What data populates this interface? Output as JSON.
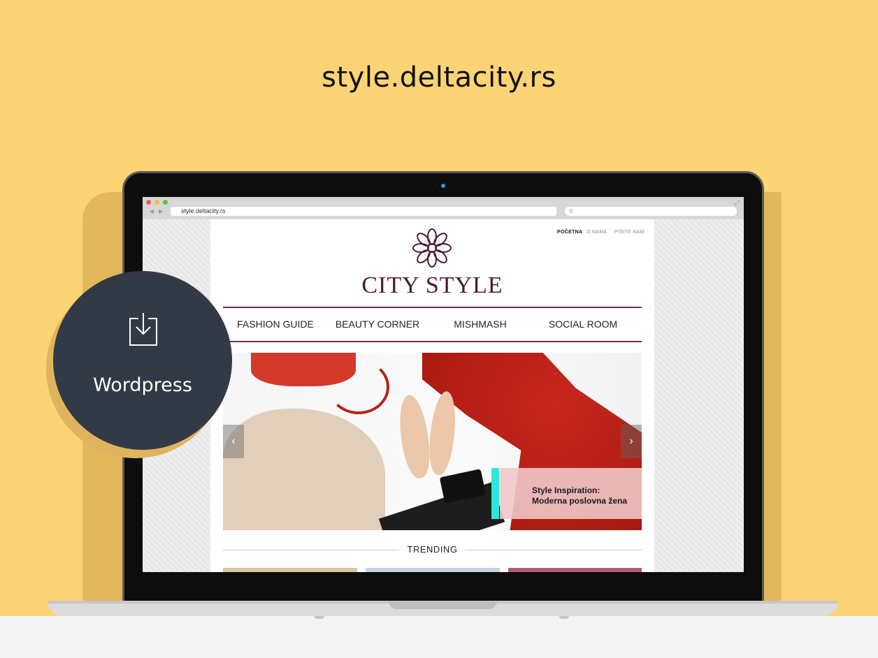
{
  "headline": "style.deltacity.rs",
  "badge": {
    "label": "Wordpress",
    "icon": "download-icon"
  },
  "browser": {
    "url": "style.deltacity.rs",
    "traffic_lights": [
      "#ee5c54",
      "#f3be4f",
      "#59c43b"
    ]
  },
  "site": {
    "top_nav": [
      {
        "label": "POČETNA",
        "active": true
      },
      {
        "label": "O NAMA",
        "active": false
      },
      {
        "label": "PIŠITE NAM",
        "active": false
      }
    ],
    "brand": "CITY STYLE",
    "logo_icon": "flower-logo-icon",
    "menu": [
      "FASHION GUIDE",
      "BEAUTY CORNER",
      "MISHMASH",
      "SOCIAL ROOM"
    ],
    "hero": {
      "caption_line1": "Style Inspiration:",
      "caption_line2": "Moderna poslovna žena",
      "accent": "#2be8da"
    },
    "section_title": "TRENDING"
  },
  "colors": {
    "background": "#fdd475",
    "brand": "#4a1a35",
    "badge": "#323a46"
  }
}
